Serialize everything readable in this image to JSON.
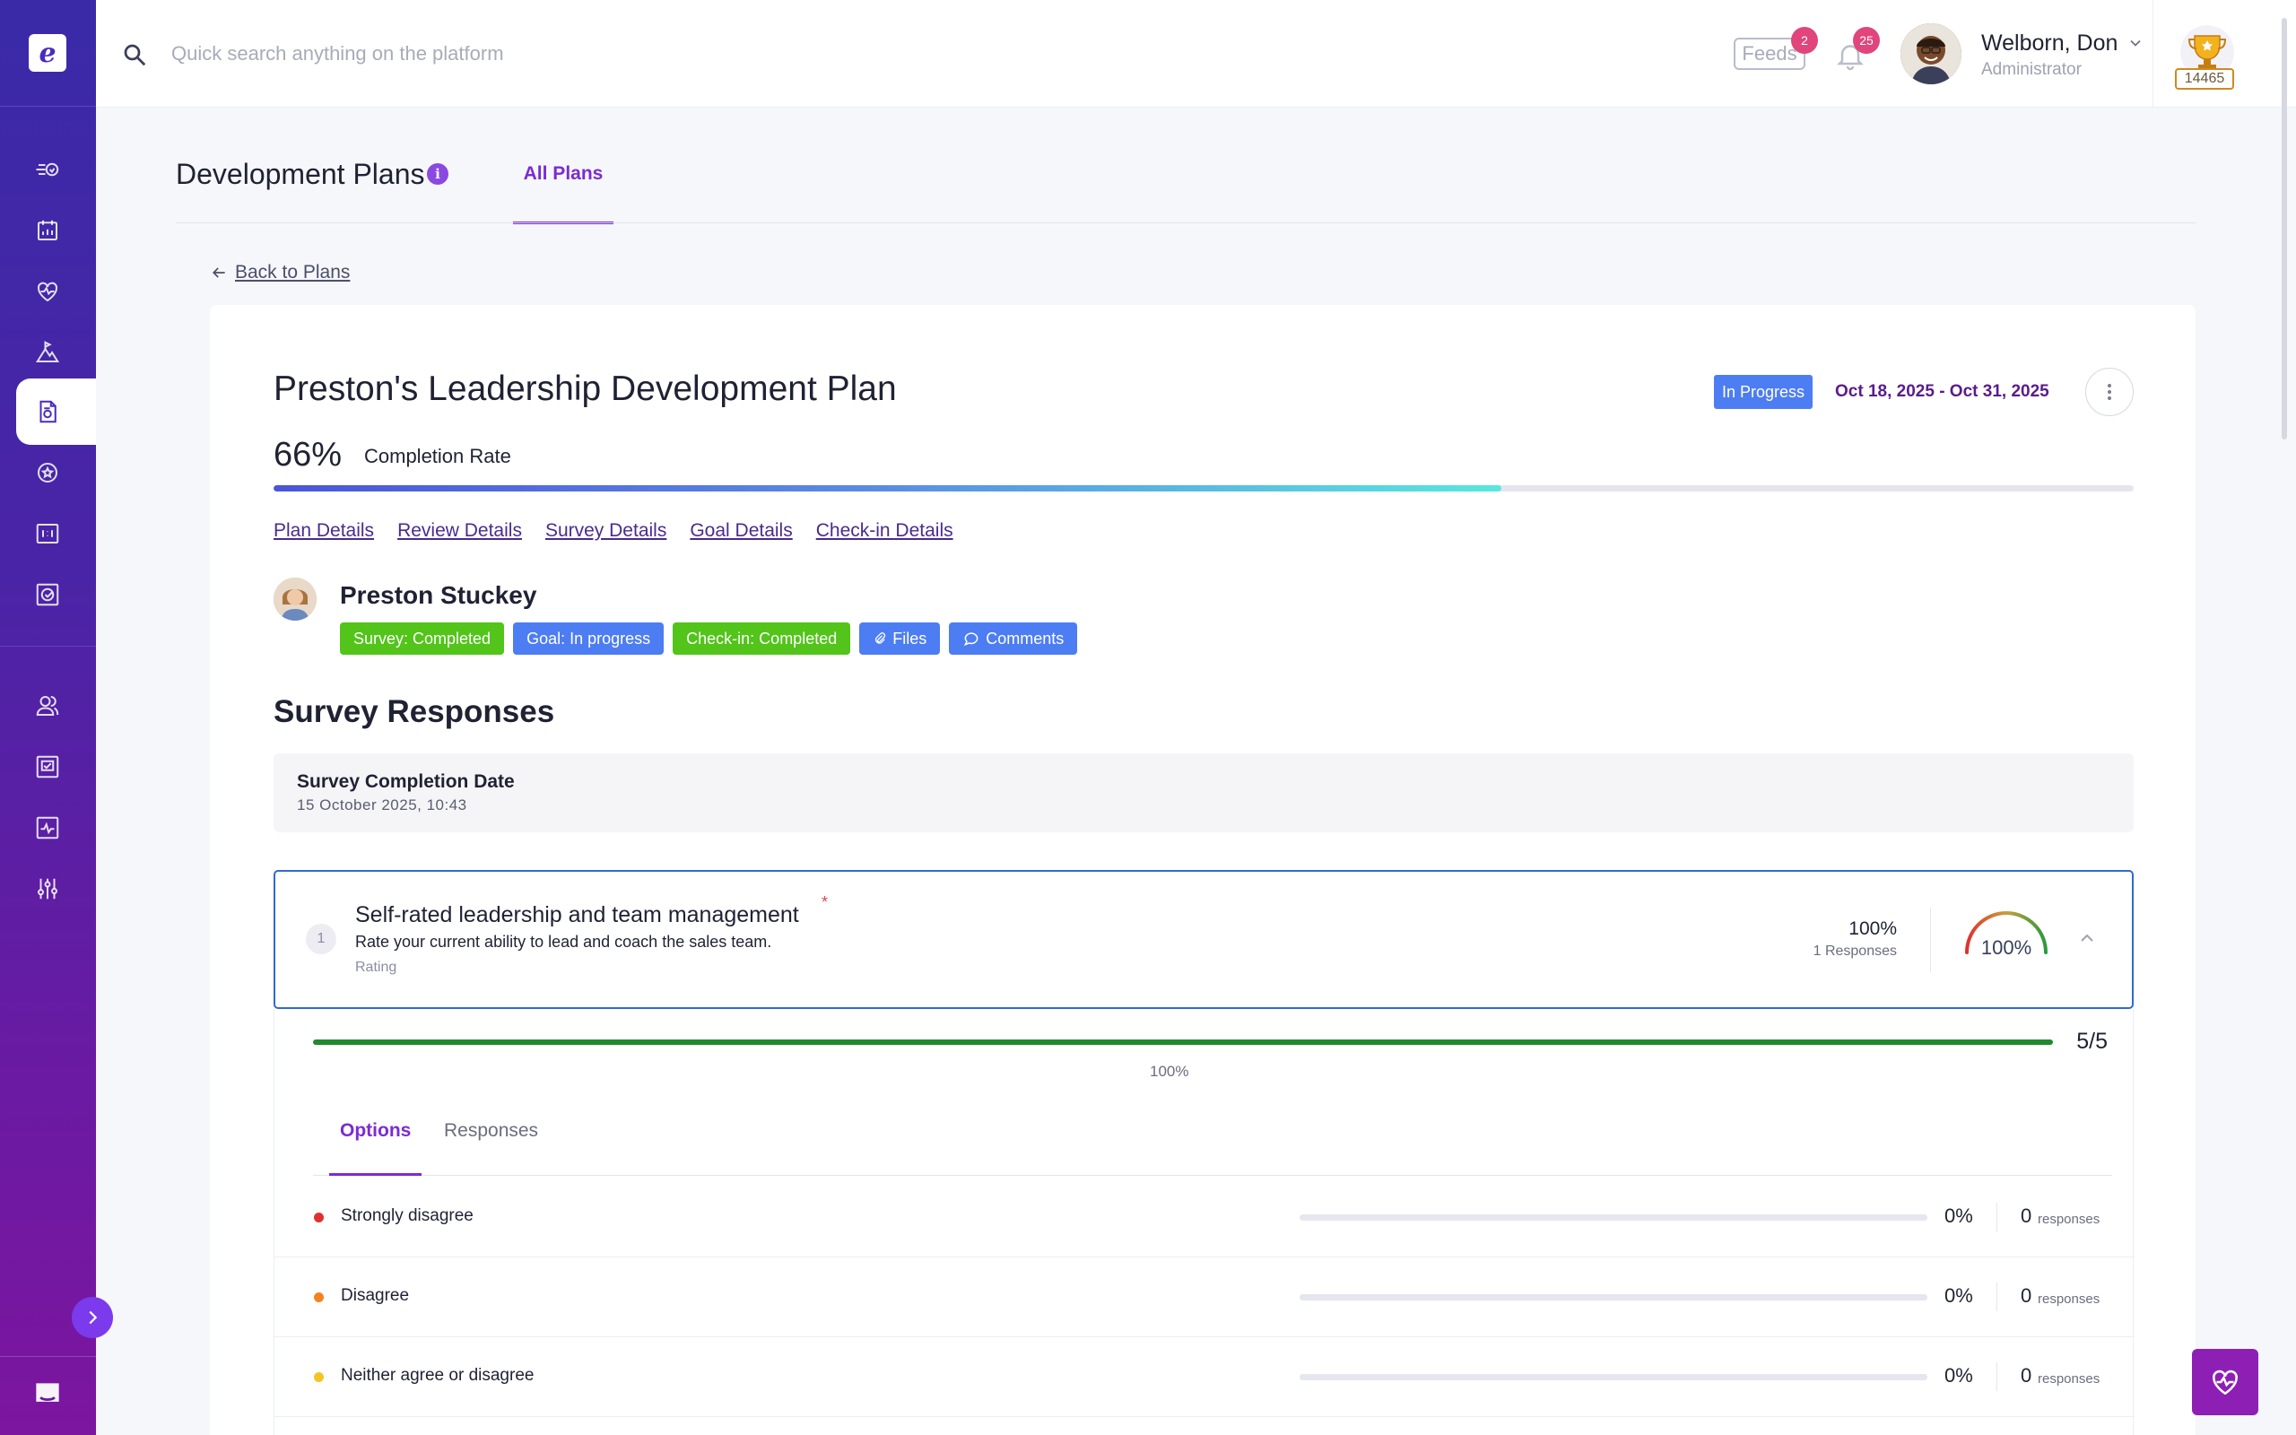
{
  "topbar": {
    "search_placeholder": "Quick search anything on the platform",
    "feeds_label": "Feeds",
    "feeds_badge": "2",
    "notifications_badge": "25",
    "user_name": "Welborn, Don",
    "user_role": "Administrator",
    "points": "14465"
  },
  "page": {
    "title": "Development Plans",
    "tab_all_plans": "All Plans",
    "back_link": "Back to Plans"
  },
  "plan": {
    "title": "Preston's Leadership Development Plan",
    "status": "In Progress",
    "date_range": "Oct 18, 2025 - Oct 31, 2025",
    "completion_pct": "66%",
    "completion_value": 0.66,
    "completion_label": "Completion Rate",
    "detail_links": [
      "Plan Details",
      "Review Details",
      "Survey Details",
      "Goal Details",
      "Check-in Details"
    ]
  },
  "person": {
    "name": "Preston Stuckey",
    "tags": [
      "Survey: Completed",
      "Goal: In progress",
      "Check-in: Completed",
      "Files",
      "Comments"
    ]
  },
  "survey": {
    "section_title": "Survey Responses",
    "completion_label": "Survey Completion Date",
    "completion_date": "15 October 2025, 10:43"
  },
  "question": {
    "number": "1",
    "title": "Self-rated leadership and team management",
    "required_mark": "*",
    "description": "Rate your current ability to lead and coach the sales team.",
    "type": "Rating",
    "pct": "100%",
    "responses": "1 Responses",
    "gauge_label": "100%",
    "gauge_value": 1.0,
    "rating_score": "5/5",
    "rating_value": 1.0,
    "rating_caption": "100%",
    "tabs": [
      "Options",
      "Responses"
    ]
  },
  "options": [
    {
      "label": "Strongly disagree",
      "pct": "0%",
      "count": "0",
      "count_label": "responses",
      "color": "#e0312f",
      "value": 0
    },
    {
      "label": "Disagree",
      "pct": "0%",
      "count": "0",
      "count_label": "responses",
      "color": "#f5821f",
      "value": 0
    },
    {
      "label": "Neither agree or disagree",
      "pct": "0%",
      "count": "0",
      "count_label": "responses",
      "color": "#f2c521",
      "value": 0
    }
  ],
  "colors": {
    "brand": "#7c2bd1",
    "status_blue": "#4d7df2",
    "status_green": "#52c41a",
    "question_border": "#2f6ad1"
  }
}
